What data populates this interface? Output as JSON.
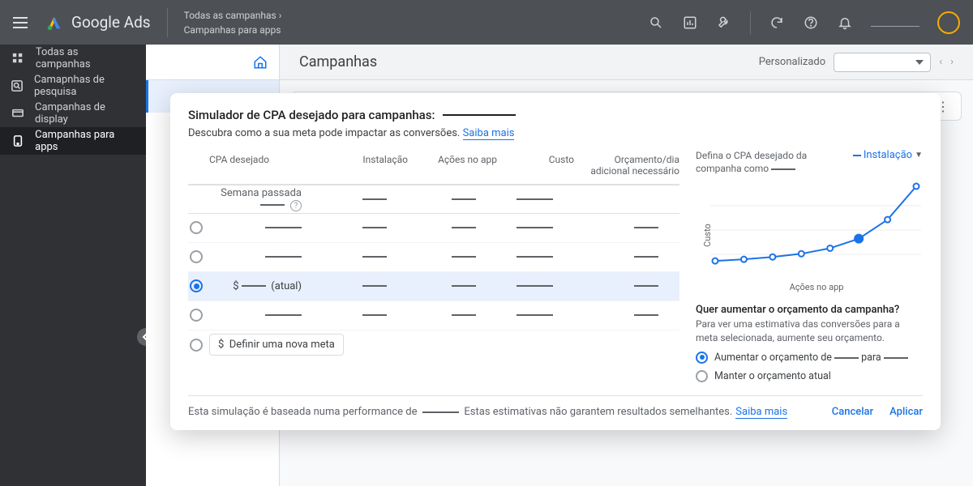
{
  "header": {
    "product": "Google Ads",
    "breadcrumb_parent": "Todas as campanhas",
    "breadcrumb_chevron": "›",
    "breadcrumb_current": "Campanhas para apps"
  },
  "sidebar": {
    "items": [
      {
        "label": "Todas as campanhas"
      },
      {
        "label": "Camapnhas de pesquisa"
      },
      {
        "label": "Campanhas de display"
      },
      {
        "label": "Campanhas para apps"
      }
    ]
  },
  "main": {
    "title": "Campanhas",
    "date_label": "Personalizado"
  },
  "modal": {
    "title": "Simulador de CPA desejado para campanhas:",
    "subtitle_pre": "Descubra como a sua meta pode impactar as conversões. ",
    "learn_more": "Saiba mais",
    "columns": {
      "cpa": "CPA desejado",
      "install": "Instalação",
      "inapp": "Ações no app",
      "cost": "Custo",
      "budget": "Orçamento/dia adicional necessário"
    },
    "last_week_label": "Semana passada",
    "current_marker": "(atual)",
    "currency_prefix": "$",
    "define_new_goal": "Definir uma nova meta",
    "footer_pre": "Esta simulação é baseada numa performance de",
    "footer_post": "Estas estimativas não garantem resultados semelhantes.",
    "footer_learn": "Saiba mais",
    "cancel": "Cancelar",
    "apply": "Aplicar"
  },
  "chart": {
    "define_label_pre": "Defina o CPA desejado da companha como",
    "legend": "Instalação",
    "ylabel": "Custo",
    "xlabel": "Ações no app",
    "budget_q": "Quer aumentar o orçamento da campanha?",
    "budget_sub": "Para ver uma estimativa das conversões para a meta selecionada, aumente seu orçamento.",
    "opt_increase_pre": "Aumentar o orçamento de",
    "opt_increase_mid": "para",
    "opt_keep": "Manter o orçamento atual"
  },
  "chart_data": {
    "type": "line",
    "xlabel": "Ações no app",
    "ylabel": "Custo",
    "x": [
      0,
      1,
      2,
      3,
      4,
      5,
      6,
      7
    ],
    "y": [
      6,
      8,
      11,
      15,
      22,
      34,
      58,
      100
    ],
    "highlight_index": 5,
    "xlim": [
      0,
      7
    ],
    "ylim": [
      0,
      100
    ]
  }
}
